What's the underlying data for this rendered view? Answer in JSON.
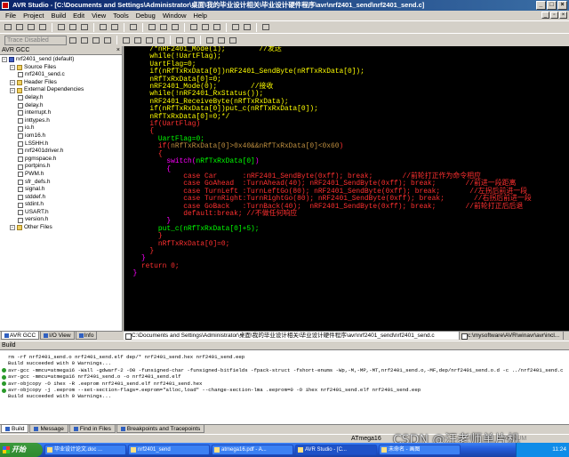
{
  "window": {
    "title": "AVR Studio - [C:\\Documents and Settings\\Administrator\\桌面\\我的毕业设计相关\\毕业设计硬件程序\\avr\\nrf2401_send\\nrf2401_send.c]"
  },
  "menu": [
    "File",
    "Project",
    "Build",
    "Edit",
    "View",
    "Tools",
    "Debug",
    "Window",
    "Help"
  ],
  "toolbar": {
    "trace_combo": "Trace Disabled"
  },
  "left_panel": {
    "header": "AVR GCC",
    "tree": [
      {
        "level": 0,
        "label": "nrf2401_send (default)",
        "icon": "project-icon"
      },
      {
        "level": 1,
        "label": "Source Files",
        "icon": "folder-icon"
      },
      {
        "level": 2,
        "label": "nrf2401_send.c",
        "icon": "file-icon"
      },
      {
        "level": 1,
        "label": "Header Files",
        "icon": "folder-icon"
      },
      {
        "level": 1,
        "label": "External Dependencies",
        "icon": "folder-icon"
      },
      {
        "level": 2,
        "label": "delay.h",
        "icon": "file-icon"
      },
      {
        "level": 2,
        "label": "delay.h",
        "icon": "file-icon"
      },
      {
        "level": 2,
        "label": "interrupt.h",
        "icon": "file-icon"
      },
      {
        "level": 2,
        "label": "inttypes.h",
        "icon": "file-icon"
      },
      {
        "level": 2,
        "label": "io.h",
        "icon": "file-icon"
      },
      {
        "level": 2,
        "label": "iom16.h",
        "icon": "file-icon"
      },
      {
        "level": 2,
        "label": "LS5HH.h",
        "icon": "file-icon"
      },
      {
        "level": 2,
        "label": "nrf2401driver.h",
        "icon": "file-icon"
      },
      {
        "level": 2,
        "label": "pgmspace.h",
        "icon": "file-icon"
      },
      {
        "level": 2,
        "label": "portpins.h",
        "icon": "file-icon"
      },
      {
        "level": 2,
        "label": "PWM.h",
        "icon": "file-icon"
      },
      {
        "level": 2,
        "label": "sfr_defs.h",
        "icon": "file-icon"
      },
      {
        "level": 2,
        "label": "signal.h",
        "icon": "file-icon"
      },
      {
        "level": 2,
        "label": "stddef.h",
        "icon": "file-icon"
      },
      {
        "level": 2,
        "label": "stdint.h",
        "icon": "file-icon"
      },
      {
        "level": 2,
        "label": "USART.h",
        "icon": "file-icon"
      },
      {
        "level": 2,
        "label": "version.h",
        "icon": "file-icon"
      },
      {
        "level": 1,
        "label": "Other Files",
        "icon": "folder-icon"
      }
    ],
    "tabs": [
      "AVR GCC",
      "I/O View",
      "Info"
    ]
  },
  "editor": {
    "lines": [
      [
        {
          "t": "      /*nRF2401_Mode(1);        //发送",
          "c": "ylw"
        }
      ],
      [
        {
          "t": "      while(!UartFlag);",
          "c": "ylw"
        }
      ],
      [
        {
          "t": "      UartFlag=0;",
          "c": "ylw"
        }
      ],
      [
        {
          "t": "      if(nRfTxRxData[0])nRF2401_SendByte(nRfTxRxData[0]);",
          "c": "ylw"
        }
      ],
      [
        {
          "t": "      nRfTxRxData[0]=0;",
          "c": "ylw"
        }
      ],
      [
        {
          "t": "      nRF2401_Mode(0);        //接收",
          "c": "ylw"
        }
      ],
      [
        {
          "t": "      while(!nRF2401_RxStatus());",
          "c": "ylw"
        }
      ],
      [
        {
          "t": "      nRF2401_ReceiveByte(nRfTxRxData);",
          "c": "ylw"
        }
      ],
      [
        {
          "t": "      if(nRfTxRxData[0])put_c(nRfTxRxData[0]);",
          "c": "ylw"
        }
      ],
      [
        {
          "t": "      nRfTxRxData[0]=0;*/",
          "c": "ylw"
        }
      ],
      [
        {
          "t": "      if(UartFlag)",
          "c": "red"
        }
      ],
      [
        {
          "t": "      {",
          "c": "red"
        }
      ],
      [
        {
          "t": "        UartFlag=0;",
          "c": "grn"
        }
      ],
      [
        {
          "t": "        if(",
          "c": "red"
        },
        {
          "t": "nRfTxRxData[0]>0x40&&nRfTxRxData[0]<0x60",
          "c": "brn"
        },
        {
          "t": ")",
          "c": "red"
        }
      ],
      [
        {
          "t": "        {",
          "c": "red"
        }
      ],
      [
        {
          "t": "          switch(",
          "c": "mag"
        },
        {
          "t": "nRfTxRxData[0]",
          "c": "grn"
        },
        {
          "t": ")",
          "c": "mag"
        }
      ],
      [
        {
          "t": "          {",
          "c": "mag"
        }
      ],
      [
        {
          "t": "              case Car      :nRF2401_SendByte(0xff); break;       //前轮打正作为命令相应",
          "c": "red"
        }
      ],
      [
        {
          "t": "              case GoAhead  :TurnAhead(40); nRF2401_SendByte(0xff); break;       //前进一段距离",
          "c": "red"
        }
      ],
      [
        {
          "t": "              case TurnLeft :TurnLeftGo(80); nRF2401_SendByte(0xff); break;       //左拐后前进一段",
          "c": "red"
        }
      ],
      [
        {
          "t": "              case TurnRight:TurnRightGo(80); nRF2401_SendByte(0xff); break;       //右拐后前进一段",
          "c": "red"
        }
      ],
      [
        {
          "t": "              case GoBack   :TurnBack(40);  nRF2401_SendByte(0xff); break;       //前轮打正后后退",
          "c": "red"
        }
      ],
      [
        {
          "t": "              default:break; //不做任何响应",
          "c": "red"
        }
      ],
      [
        {
          "t": "          }",
          "c": "mag"
        }
      ],
      [
        {
          "t": "        put_c(nRfTxRxData[0]+5);",
          "c": "grn"
        }
      ],
      [
        {
          "t": "        }",
          "c": "red"
        }
      ],
      [
        {
          "t": "        nRfTxRxData[0]=0;",
          "c": "red"
        }
      ],
      [
        {
          "t": "      }",
          "c": "red"
        }
      ],
      [
        {
          "t": "    }",
          "c": "mag"
        }
      ],
      [
        {
          "t": "    return 0;",
          "c": "red"
        }
      ],
      [
        {
          "t": "  }",
          "c": "mag"
        }
      ]
    ],
    "tabs": [
      "C:\\Documents and Settings\\Administrator\\桌面\\我的毕业设计相关\\毕业设计硬件程序\\avr\\nrf2401_send\\nrf2401_send.c",
      "c:\\mysoftware\\AVR\\winavr\\avr\\incl..."
    ]
  },
  "build": {
    "header": "Build",
    "lines": [
      {
        "dot": false,
        "text": "rm -rf nrf2401_send.o  nrf2401_send.elf dep/* nrf2401_send.hex nrf2401_send.eep"
      },
      {
        "dot": false,
        "text": "Build succeeded with 0 Warnings..."
      },
      {
        "dot": true,
        "text": "avr-gcc -mmcu=atmega16 -Wall -gdwarf-2 -O0 -funsigned-char -funsigned-bitfields -fpack-struct -fshort-enums -Wp,-M,-MP,-MT,nrf2401_send.o,-MF,dep/nrf2401_send.o.d  -c   ../nrf2401_send.c"
      },
      {
        "dot": true,
        "text": "avr-gcc -mmcu=atmega16  nrf2401_send.o     -o nrf2401_send.elf"
      },
      {
        "dot": true,
        "text": "avr-objcopy -O ihex -R .eeprom  nrf2401_send.elf nrf2401_send.hex"
      },
      {
        "dot": true,
        "text": "avr-objcopy -j .eeprom --set-section-flags=.eeprom=\"alloc,load\" --change-section-lma .eeprom=0 -O ihex nrf2401_send.elf nrf2401_send.eep"
      },
      {
        "dot": false,
        "text": "Build succeeded with 0 Warnings..."
      }
    ],
    "tabs": [
      "Build",
      "Message",
      "Find in Files",
      "Breakpoints and Tracepoints"
    ]
  },
  "status": {
    "device": "ATmega16",
    "caps": "CAP  NUM"
  },
  "watermark": "CSDN @汪老师单片机",
  "taskbar": {
    "start": "开始",
    "tasks": [
      "毕业设计论文.doc ...",
      "nrf2401_send",
      "atmega16.pdf - A...",
      "AVR Studio - [C...",
      "未命名 - 画图"
    ],
    "active_task": 3,
    "clock": "11:24"
  }
}
